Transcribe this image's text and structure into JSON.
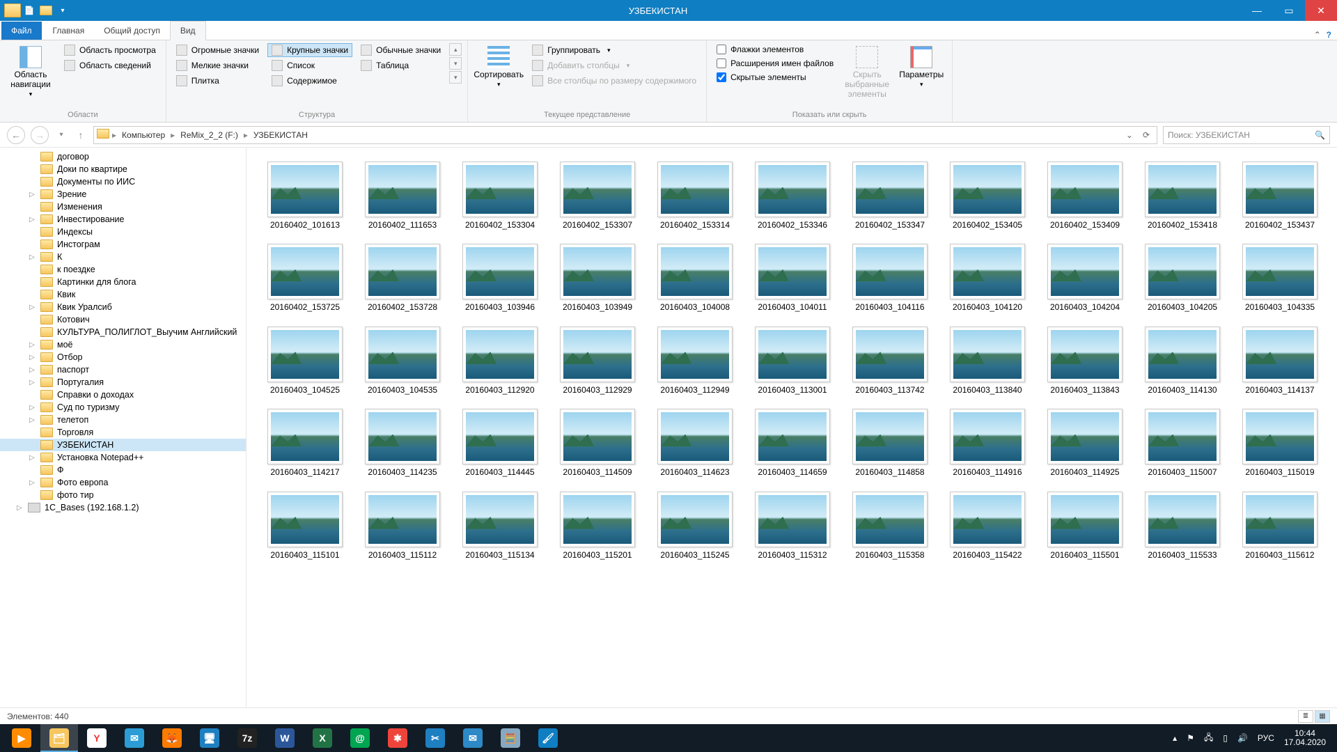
{
  "window": {
    "title": "УЗБЕКИСТАН"
  },
  "tabs": {
    "file": "Файл",
    "home": "Главная",
    "share": "Общий доступ",
    "view": "Вид"
  },
  "ribbon": {
    "areas": {
      "nav_pane": "Область навигации",
      "preview_pane": "Область просмотра",
      "details_pane": "Область сведений",
      "group_label": "Области"
    },
    "layout": {
      "huge": "Огромные значки",
      "large": "Крупные значки",
      "normal": "Обычные значки",
      "small": "Мелкие значки",
      "list": "Список",
      "table": "Таблица",
      "tiles": "Плитка",
      "content": "Содержимое",
      "group_label": "Структура"
    },
    "current_view": {
      "sort": "Сортировать",
      "group_by": "Группировать",
      "add_columns": "Добавить столбцы",
      "size_all": "Все столбцы по размеру содержимого",
      "group_label": "Текущее представление"
    },
    "show_hide": {
      "item_checkboxes": "Флажки элементов",
      "file_ext": "Расширения имен файлов",
      "hidden": "Скрытые элементы",
      "hide_selected": "Скрыть выбранные элементы",
      "options": "Параметры",
      "group_label": "Показать или скрыть"
    }
  },
  "breadcrumb": [
    "Компьютер",
    "ReMix_2_2 (F:)",
    "УЗБЕКИСТАН"
  ],
  "search": {
    "placeholder": "Поиск: УЗБЕКИСТАН"
  },
  "tree": [
    {
      "label": "договор",
      "expander": "",
      "indent": 2
    },
    {
      "label": "Доки по квартире",
      "expander": "",
      "indent": 2
    },
    {
      "label": "Документы по ИИС",
      "expander": "",
      "indent": 2
    },
    {
      "label": "Зрение",
      "expander": "▷",
      "indent": 2
    },
    {
      "label": "Изменения",
      "expander": "",
      "indent": 2
    },
    {
      "label": "Инвестирование",
      "expander": "▷",
      "indent": 2
    },
    {
      "label": "Индексы",
      "expander": "",
      "indent": 2
    },
    {
      "label": "Инстограм",
      "expander": "",
      "indent": 2
    },
    {
      "label": "К",
      "expander": "▷",
      "indent": 2
    },
    {
      "label": "к поездке",
      "expander": "",
      "indent": 2
    },
    {
      "label": "Картинки для блога",
      "expander": "",
      "indent": 2
    },
    {
      "label": "Квик",
      "expander": "",
      "indent": 2
    },
    {
      "label": "Квик Уралсиб",
      "expander": "▷",
      "indent": 2
    },
    {
      "label": "Котович",
      "expander": "",
      "indent": 2
    },
    {
      "label": "КУЛЬТУРА_ПОЛИГЛОТ_Выучим Английский",
      "expander": "",
      "indent": 2
    },
    {
      "label": "моё",
      "expander": "▷",
      "indent": 2
    },
    {
      "label": "Отбор",
      "expander": "▷",
      "indent": 2
    },
    {
      "label": "паспорт",
      "expander": "▷",
      "indent": 2
    },
    {
      "label": "Португалия",
      "expander": "▷",
      "indent": 2
    },
    {
      "label": "Справки о доходах",
      "expander": "",
      "indent": 2
    },
    {
      "label": "Суд по туризму",
      "expander": "▷",
      "indent": 2
    },
    {
      "label": "телетоп",
      "expander": "▷",
      "indent": 2
    },
    {
      "label": "Торговля",
      "expander": "",
      "indent": 2
    },
    {
      "label": "УЗБЕКИСТАН",
      "expander": "",
      "indent": 2,
      "selected": true
    },
    {
      "label": "Установка Notepad++",
      "expander": "▷",
      "indent": 2
    },
    {
      "label": "Ф",
      "expander": "",
      "indent": 2
    },
    {
      "label": "Фото европа",
      "expander": "▷",
      "indent": 2
    },
    {
      "label": "фото тир",
      "expander": "",
      "indent": 2
    },
    {
      "label": "1C_Bases (192.168.1.2)",
      "expander": "▷",
      "indent": 1,
      "icon": "drive"
    }
  ],
  "files": [
    "20160402_101613",
    "20160402_111653",
    "20160402_153304",
    "20160402_153307",
    "20160402_153314",
    "20160402_153346",
    "20160402_153347",
    "20160402_153405",
    "20160402_153409",
    "20160402_153418",
    "20160402_153437",
    "20160402_153725",
    "20160402_153728",
    "20160403_103946",
    "20160403_103949",
    "20160403_104008",
    "20160403_104011",
    "20160403_104116",
    "20160403_104120",
    "20160403_104204",
    "20160403_104205",
    "20160403_104335",
    "20160403_104525",
    "20160403_104535",
    "20160403_112920",
    "20160403_112929",
    "20160403_112949",
    "20160403_113001",
    "20160403_113742",
    "20160403_113840",
    "20160403_113843",
    "20160403_114130",
    "20160403_114137",
    "20160403_114217",
    "20160403_114235",
    "20160403_114445",
    "20160403_114509",
    "20160403_114623",
    "20160403_114659",
    "20160403_114858",
    "20160403_114916",
    "20160403_114925",
    "20160403_115007",
    "20160403_115019",
    "20160403_115101",
    "20160403_115112",
    "20160403_115134",
    "20160403_115201",
    "20160403_115245",
    "20160403_115312",
    "20160403_115358",
    "20160403_115422",
    "20160403_115501",
    "20160403_115533",
    "20160403_115612"
  ],
  "status": {
    "items_label": "Элементов:",
    "items_count": "440"
  },
  "tray": {
    "lang": "РУС",
    "time": "10:44",
    "date": "17.04.2020"
  },
  "taskbar": [
    {
      "name": "media-player",
      "bg": "#ff8c00",
      "glyph": "▶"
    },
    {
      "name": "file-explorer",
      "bg": "#f7c65e",
      "glyph": "🗂",
      "active": true
    },
    {
      "name": "yandex-browser",
      "bg": "#ffffff",
      "glyph": "Y",
      "fg": "#e33"
    },
    {
      "name": "mail",
      "bg": "#2c9cd6",
      "glyph": "✉"
    },
    {
      "name": "firefox",
      "bg": "#ff7b00",
      "glyph": "🦊"
    },
    {
      "name": "remote-desktop",
      "bg": "#1e7fc1",
      "glyph": "🖥"
    },
    {
      "name": "7zip",
      "bg": "#222",
      "glyph": "7z"
    },
    {
      "name": "word",
      "bg": "#2b579a",
      "glyph": "W"
    },
    {
      "name": "excel",
      "bg": "#217346",
      "glyph": "X"
    },
    {
      "name": "at-app",
      "bg": "#00a551",
      "glyph": "@"
    },
    {
      "name": "anydesk",
      "bg": "#ef443b",
      "glyph": "✱"
    },
    {
      "name": "snipping-tool",
      "bg": "#1e7fc1",
      "glyph": "✂"
    },
    {
      "name": "thunderbird",
      "bg": "#2e89c7",
      "glyph": "✉"
    },
    {
      "name": "calculator",
      "bg": "#87a8c1",
      "glyph": "🧮"
    },
    {
      "name": "paint",
      "bg": "#0f7ec2",
      "glyph": "🖌"
    }
  ]
}
